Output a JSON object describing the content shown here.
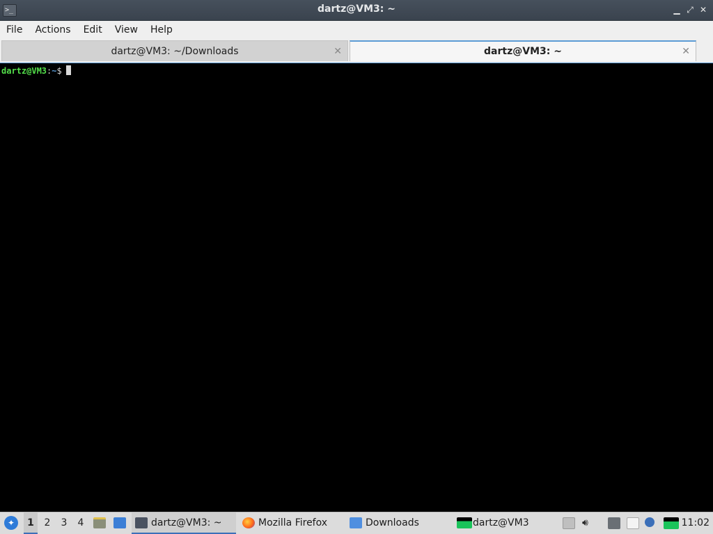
{
  "window": {
    "title": "dartz@VM3: ~",
    "controls": {
      "minimize": "▁",
      "maximize": "⤢",
      "close": "✕"
    }
  },
  "menu": [
    "File",
    "Actions",
    "Edit",
    "View",
    "Help"
  ],
  "tabs": [
    {
      "label": "dartz@VM3: ~/Downloads",
      "active": false,
      "close": "✕"
    },
    {
      "label": "dartz@VM3: ~",
      "active": true,
      "close": "✕"
    }
  ],
  "terminal": {
    "prompt_user": "dartz@VM3",
    "prompt_sep": ":",
    "prompt_dir": "~",
    "prompt_symbol": "$"
  },
  "taskbar": {
    "desktops": [
      "1",
      "2",
      "3",
      "4"
    ],
    "active_desktop": "1",
    "tasks": [
      {
        "label": "dartz@VM3: ~",
        "icon": "terminal-icon",
        "active": true
      },
      {
        "label": "Mozilla Firefox",
        "icon": "firefox-icon",
        "active": false
      },
      {
        "label": "Downloads",
        "icon": "folder-icon",
        "active": false
      },
      {
        "label": "dartz@VM3",
        "icon": "terminal-green-icon",
        "active": false
      }
    ],
    "clock": "11:02"
  },
  "colors": {
    "accent": "#5b9bd5",
    "prompt_user": "#54e04b",
    "terminal_bg": "#000000"
  }
}
